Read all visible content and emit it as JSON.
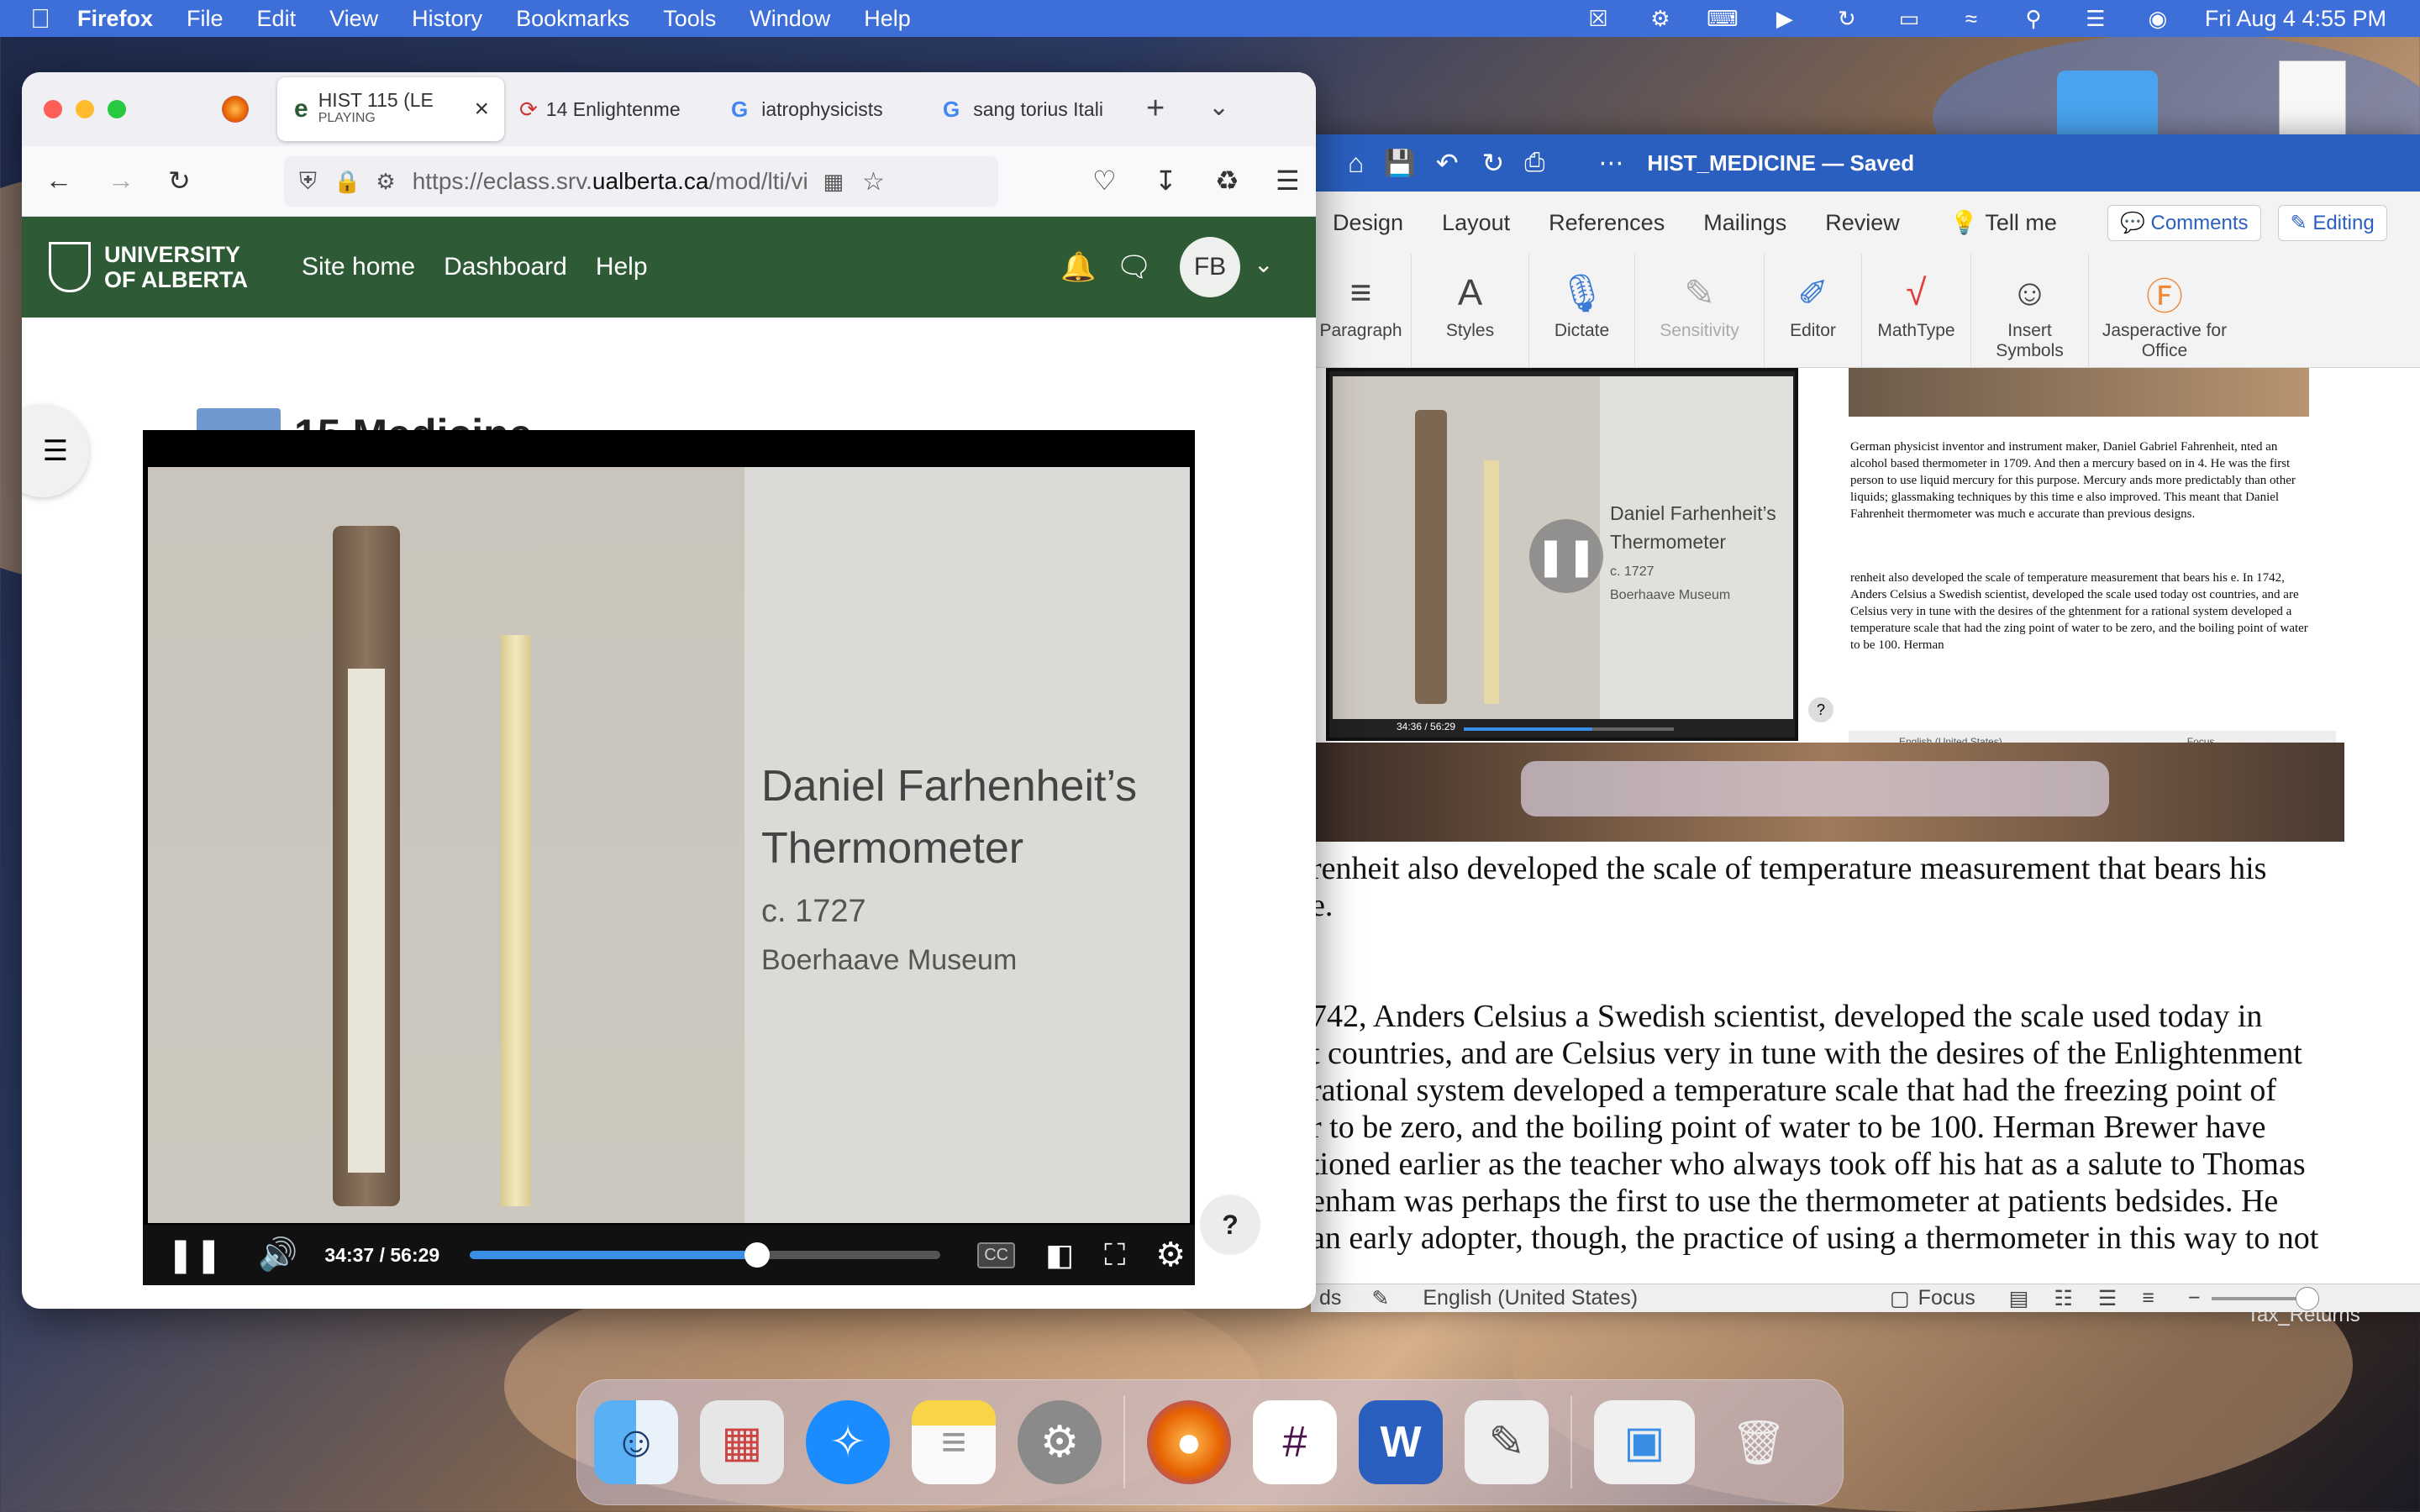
{
  "menubar": {
    "app": "Firefox",
    "items": [
      "File",
      "Edit",
      "View",
      "History",
      "Bookmarks",
      "Tools",
      "Window",
      "Help"
    ],
    "clock": "Fri Aug 4  4:55 PM"
  },
  "desktop": {
    "file_label": "Tax_Returns"
  },
  "firefox": {
    "tabs": [
      {
        "title": "HIST 115 (LE",
        "subtitle": "PLAYING",
        "active": true
      },
      {
        "title": "14 Enlightenme"
      },
      {
        "title": "iatrophysicists"
      },
      {
        "title": "sang torius Itali"
      }
    ],
    "url_prefix": "https://eclass.srv.",
    "url_domain": "ualberta.ca",
    "url_suffix": "/mod/lti/view.",
    "site": {
      "logo_line1": "UNIVERSITY",
      "logo_line2": "OF ALBERTA",
      "nav": [
        "Site home",
        "Dashboard",
        "Help"
      ],
      "avatar": "FB"
    },
    "page_title": "15 Medicine",
    "video": {
      "slide_title1": "Daniel Farhenheit’s",
      "slide_title2": "Thermometer",
      "slide_date": "c. 1727",
      "slide_source": "Boerhaave Museum",
      "time": "34:37 / 56:29",
      "progress": 0.61,
      "cc": "CC",
      "help": "?"
    }
  },
  "word": {
    "doc_title": "HIST_MEDICINE — Saved",
    "tabs": [
      "Design",
      "Layout",
      "References",
      "Mailings",
      "Review",
      "Tell me"
    ],
    "comments": "Comments",
    "editing": "Editing",
    "ribbon": [
      "Paragraph",
      "Styles",
      "Dictate",
      "Sensitivity",
      "Editor",
      "MathType",
      "Insert Symbols",
      "Jasperactive for Office"
    ],
    "body_lines": [
      "renheit also developed the scale of temperature measurement that bears his",
      "e.",
      "",
      "742, Anders Celsius a Swedish scientist, developed the scale used today in",
      "t countries, and are Celsius very in tune with the desires of the Enlightenment",
      "rational system developed a temperature scale that had the freezing point of",
      "r to be zero, and the boiling point of water to be 100. Herman Brewer have",
      "tioned earlier as the teacher who always took off his hat as a salute to Thomas",
      "enham was perhaps the first to use the thermometer at patients bedsides. He",
      " an early adopter, though, the practice of using a thermometer in this way to not"
    ],
    "status": {
      "lang": "English (United States)",
      "focus": "Focus",
      "ds": "ds"
    },
    "thumb_paragraphs": [
      "German physicist inventor and instrument maker, Daniel Gabriel Fahrenheit, nted an alcohol based thermometer in 1709. And then a mercury based on in 4. He was the first person to use liquid mercury for this purpose. Mercury ands more predictably than other liquids; glassmaking techniques by this time e also improved. This meant that Daniel Fahrenheit thermometer was much e accurate than previous designs.",
      "renheit also developed the scale of temperature measurement that bears his e. In 1742, Anders Celsius a Swedish scientist, developed the scale used today ost countries, and are Celsius very in tune with the desires of the ghtenment for a rational system developed a temperature scale that had the zing point of water to be zero, and the boiling point of water to be 100. Herman"
    ],
    "thumb_status": {
      "lang": "English (United States)",
      "focus": "Focus"
    },
    "thumb_time": "34:36 / 56:29"
  }
}
